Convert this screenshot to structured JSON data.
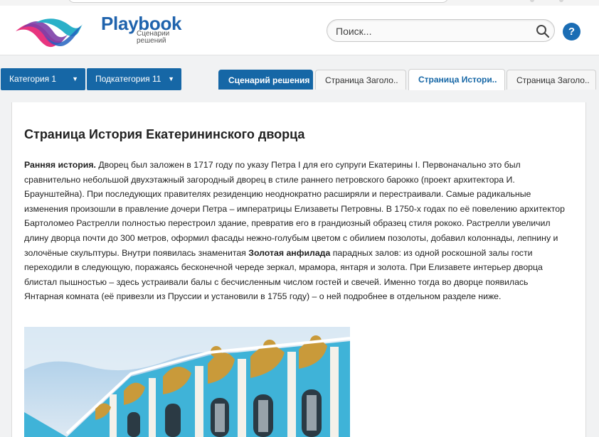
{
  "header": {
    "logo_title": "Playbook",
    "logo_subtitle_line1": "Сценарии",
    "logo_subtitle_line2": "решений",
    "search_placeholder": "Поиск...",
    "help_label": "?"
  },
  "nav": {
    "dropdowns": [
      {
        "label": "Категория 1",
        "arrow": "▼"
      },
      {
        "label": "Подкатегория 11",
        "arrow": "▼"
      }
    ],
    "tabs": [
      {
        "label": "Сценарий решения",
        "state": "primary"
      },
      {
        "label": "Страница Заголо..",
        "state": "normal"
      },
      {
        "label": "Страница Истори..",
        "state": "active"
      },
      {
        "label": "Страница Заголо..",
        "state": "normal"
      }
    ]
  },
  "page": {
    "title": "Страница История Екатерининского дворца",
    "lead_bold": "Ранняя история.",
    "text_part1": " Дворец был заложен в 1717 году по указу Петра I для его супруги Екатерины I. Первоначально это был сравнительно небольшой двухэтажный загородный дворец в стиле раннего петровского барокко (проект архитектора И. Браунштейна). При последующих правителях резиденцию неоднократно расширяли и перестраивали. Самые радикальные изменения произошли в правление дочери Петра – императрицы Елизаветы Петровны. В 1750-х годах по её повелению архитектор Бартоломео Растрелли полностью перестроил здание, превратив его в грандиозный образец стиля рококо. Растрелли увеличил длину дворца почти до 300 метров, оформил фасады нежно-голубым цветом с обилием позолоты, добавил колоннады, лепнину и золочёные скульптуры. Внутри появилась знаменитая ",
    "inline_bold": "Золотая анфилада",
    "text_part2": " парадных залов: из одной роскошной залы гости переходили в следующую, поражаясь бесконечной череде зеркал, мрамора, янтаря и золота. При Елизавете интерьер дворца блистал пышностью – здесь устраивали балы с бесчисленным числом гостей и свечей. Именно тогда во дворце появилась Янтарная комната (её привезли из Пруссии и установили в 1755 году) – о ней подробнее в отдельном разделе ниже."
  },
  "colors": {
    "brand_blue": "#1667a6",
    "logo_blue": "#1f63ad",
    "palace_turquoise": "#3fb3d8",
    "gold": "#c99a3a"
  },
  "icons": {
    "search": "magnifier",
    "help": "question-circle",
    "logo": "ribbon-waves"
  }
}
